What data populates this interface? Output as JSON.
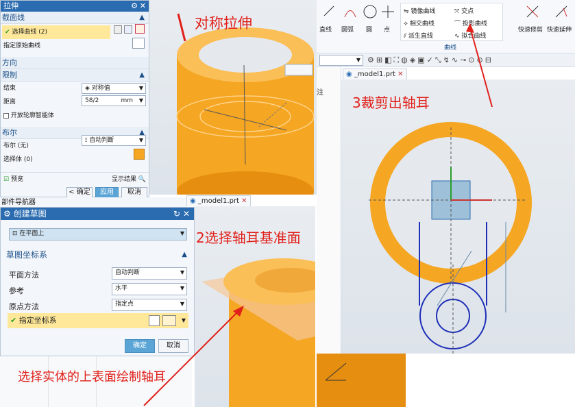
{
  "extrude_dialog": {
    "title": "拉伸",
    "section_label": "截面线",
    "select_curve": "选择曲线 (2)",
    "specify_origin_curve": "指定原始曲线",
    "direction_label": "方向",
    "limits_label": "限制",
    "end_label": "结束",
    "end_value": "对称值",
    "distance_label": "距离",
    "distance_value": "58/2",
    "distance_unit": "mm",
    "open_profile": "开放轮廓智能体",
    "boolean_label": "布尔",
    "boolean_none": "布尔 (无)",
    "boolean_value": "自动判断",
    "select_body": "选择体 (0)",
    "preview": "预览",
    "show_result": "显示结果",
    "ok": "< 确定 >",
    "apply": "应用",
    "cancel": "取消"
  },
  "sketch_dialog": {
    "navigator_label": "部件导航器",
    "title": "创建草图",
    "type_value": "在平面上",
    "csys_label": "草图坐标系",
    "plane_method_label": "平面方法",
    "plane_method_value": "自动判断",
    "reference_label": "参考",
    "reference_value": "水平",
    "origin_method_label": "原点方法",
    "origin_method_value": "指定点",
    "specify_csys": "指定坐标系",
    "ok": "确定",
    "cancel": "取消"
  },
  "ribbon": {
    "line": "直线",
    "arc": "圆弧",
    "circle": "圆",
    "point": "点",
    "mirror_curve": "镜像曲线",
    "intersect_curve": "相交曲线",
    "derived_line": "派生直线",
    "intersection_point": "交点",
    "project_curve": "投影曲线",
    "fit_curve": "拟合曲线",
    "group_label": "曲线",
    "quick_trim": "快速修剪",
    "quick_extend": "快速延伸"
  },
  "tabs": {
    "model_tab_1": "_model1.prt",
    "model_tab_2": "_model1.prt"
  },
  "annotations": {
    "step1": "对称拉伸",
    "step2": "2选择轴耳基准面",
    "step3": "3裁剪出轴耳",
    "note": "选择实体的上表面绘制轴耳"
  },
  "partial_labels": {
    "col_header": "注"
  },
  "colors": {
    "accent_blue": "#2b6cb0",
    "solid_orange": "#f5a623",
    "annotation_red": "#e1201a",
    "sketch_blue": "#1f2fb8"
  }
}
